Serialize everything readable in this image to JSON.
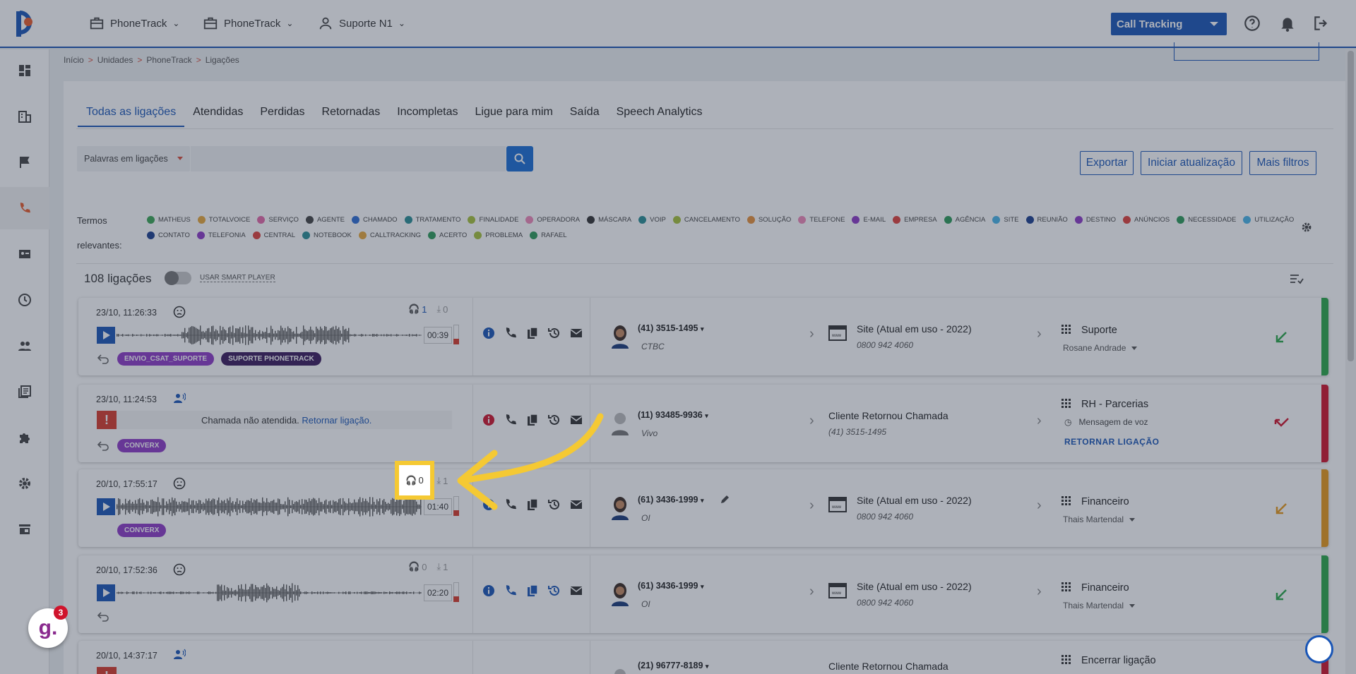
{
  "topbar": {
    "menus": [
      {
        "label": "PhoneTrack",
        "icon": "briefcase-icon"
      },
      {
        "label": "PhoneTrack",
        "icon": "briefcase-icon"
      },
      {
        "label": "Suporte N1",
        "icon": "user-icon"
      }
    ],
    "product_button": "Call Tracking"
  },
  "breadcrumb": [
    "Início",
    "Unidades",
    "PhoneTrack",
    "Ligações"
  ],
  "tabs": [
    "Todas as ligações",
    "Atendidas",
    "Perdidas",
    "Retornadas",
    "Incompletas",
    "Ligue para mim",
    "Saída",
    "Speech Analytics"
  ],
  "search": {
    "selector": "Palavras em ligações",
    "placeholder": ""
  },
  "buttons": {
    "export": "Exportar",
    "start_update": "Iniciar atualização",
    "more_filters": "Mais filtros"
  },
  "terms_label": "Termos relevantes:",
  "terms": [
    {
      "label": "MATHEUS",
      "color": "#3aa655"
    },
    {
      "label": "TOTALVOICE",
      "color": "#e8a93b"
    },
    {
      "label": "SERVIÇO",
      "color": "#e56aa8"
    },
    {
      "label": "AGENTE",
      "color": "#444444"
    },
    {
      "label": "CHAMADO",
      "color": "#2f6fd6"
    },
    {
      "label": "TRATAMENTO",
      "color": "#2a8f95"
    },
    {
      "label": "FINALIDADE",
      "color": "#a6c23a"
    },
    {
      "label": "OPERADORA",
      "color": "#f08ab8"
    },
    {
      "label": "MÁSCARA",
      "color": "#333333"
    },
    {
      "label": "VOIP",
      "color": "#2a8f95"
    },
    {
      "label": "CANCELAMENTO",
      "color": "#a6c23a"
    },
    {
      "label": "SOLUÇÃO",
      "color": "#e8913b"
    },
    {
      "label": "TELEFONE",
      "color": "#f08ab8"
    },
    {
      "label": "E-MAIL",
      "color": "#8e3bc7"
    },
    {
      "label": "EMPRESA",
      "color": "#e0413a"
    },
    {
      "label": "AGÊNCIA",
      "color": "#2e9c5a"
    },
    {
      "label": "SITE",
      "color": "#4ab5e8"
    },
    {
      "label": "REUNIÃO",
      "color": "#1c3f8f"
    },
    {
      "label": "DESTINO",
      "color": "#8e3bc7"
    },
    {
      "label": "ANÚNCIOS",
      "color": "#e0413a"
    },
    {
      "label": "NECESSIDADE",
      "color": "#2e9c5a"
    },
    {
      "label": "UTILIZAÇÃO",
      "color": "#4ab5e8"
    },
    {
      "label": "CONTATO",
      "color": "#1c3f8f"
    },
    {
      "label": "TELEFONIA",
      "color": "#8e3bc7"
    },
    {
      "label": "CENTRAL",
      "color": "#e0413a"
    },
    {
      "label": "NOTEBOOK",
      "color": "#2a8f95"
    },
    {
      "label": "CALLTRACKING",
      "color": "#e8a93b"
    },
    {
      "label": "ACERTO",
      "color": "#2e9c5a"
    },
    {
      "label": "PROBLEMA",
      "color": "#a6c23a"
    },
    {
      "label": "RAFAEL",
      "color": "#2e9c5a"
    }
  ],
  "count_label": "108 ligações",
  "smart_player": "USAR SMART PLAYER",
  "calls": [
    {
      "datetime": "23/10, 11:26:33",
      "listens": "1",
      "downloads": "0",
      "duration": "00:39",
      "tags": [
        {
          "label": "ENVIO_CSAT_SUPORTE",
          "color": "#8e3bc7"
        },
        {
          "label": "SUPORTE PHONETRACK",
          "color": "#3a1a5c"
        }
      ],
      "phone": "(41) 3515-1495",
      "carrier": "CTBC",
      "destination": "Site (Atual em uso - 2022)",
      "dest_number": "0800 942 4060",
      "department": "Suporte",
      "agent": "Rosane Andrade",
      "status_color": "#2aa84a",
      "direction_color": "#2aa84a"
    },
    {
      "datetime": "23/10, 11:24:53",
      "missed_text": "Chamada não atendida.",
      "missed_link": "Retornar ligação.",
      "tags": [
        {
          "label": "CONVERX",
          "color": "#8e3bc7"
        }
      ],
      "phone": "(11) 93485-9936",
      "carrier": "Vivo",
      "destination": "Cliente Retornou Chamada",
      "dest_number": "(41) 3515-1495",
      "department": "RH - Parcerias",
      "voice": "Mensagem de voz",
      "return_label": "RETORNAR LIGAÇÃO",
      "status_color": "#d0142c",
      "direction_color": "#d0142c"
    },
    {
      "datetime": "20/10, 17:55:17",
      "listens": "0",
      "downloads": "1",
      "duration": "01:40",
      "tags": [
        {
          "label": "CONVERX",
          "color": "#8e3bc7"
        }
      ],
      "phone": "(61) 3436-1999",
      "carrier": "OI",
      "destination": "Site (Atual em uso - 2022)",
      "dest_number": "0800 942 4060",
      "department": "Financeiro",
      "agent": "Thais Martendal",
      "status_color": "#e89a1a",
      "direction_color": "#e89a1a"
    },
    {
      "datetime": "20/10, 17:52:36",
      "listens": "0",
      "downloads": "1",
      "duration": "02:20",
      "tags": [],
      "phone": "(61) 3436-1999",
      "carrier": "OI",
      "destination": "Site (Atual em uso - 2022)",
      "dest_number": "0800 942 4060",
      "department": "Financeiro",
      "agent": "Thais Martendal",
      "status_color": "#2aa84a",
      "direction_color": "#2aa84a"
    },
    {
      "datetime": "20/10, 14:37:17",
      "phone": "(21) 96777-8189",
      "destination": "Cliente Retornou Chamada",
      "department": "Encerrar ligação",
      "status_color": "#d0142c"
    }
  ],
  "spotlight": {
    "listens": "0"
  },
  "help_badge": {
    "letter": "g.",
    "count": "3"
  }
}
